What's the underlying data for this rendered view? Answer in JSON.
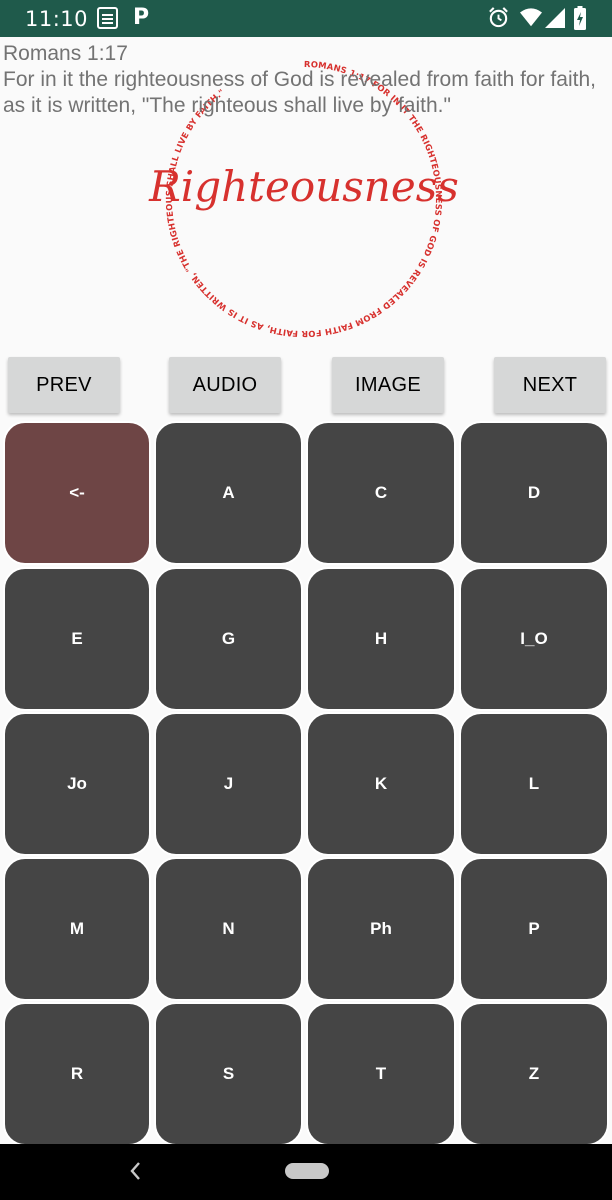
{
  "status_bar": {
    "time": "11:10",
    "icons": [
      "bible-app-icon",
      "p-icon",
      "alarm-icon",
      "wifi-icon",
      "signal-icon",
      "battery-icon"
    ],
    "p_glyph": "P"
  },
  "verse": {
    "reference": "Romans 1:17",
    "text": "For in it the righteousness of God is revealed from faith for faith, as it is written, \"The righteous shall live by faith.\""
  },
  "seal": {
    "title": "Righteousness",
    "ring_text": "ROMANS 1:17 FOR IN IT THE RIGHTEOUSNESS OF GOD IS REVEALED FROM FAITH FOR FAITH, AS IT IS WRITTEN, \"THE RIGHTEOUS SHALL LIVE BY FAITH.\"",
    "color": "#d7312e"
  },
  "actions": {
    "prev": "PREV",
    "audio": "AUDIO",
    "image": "IMAGE",
    "next": "NEXT"
  },
  "keys": [
    "<-",
    "A",
    "C",
    "D",
    "E",
    "G",
    "H",
    "I_O",
    "Jo",
    "J",
    "K",
    "L",
    "M",
    "N",
    "Ph",
    "P",
    "R",
    "S",
    "T",
    "Z"
  ],
  "colors": {
    "status_bar": "#1f5a4b",
    "key": "#454545",
    "key_active": "#6e4545",
    "action_button": "#d6d7d7"
  }
}
